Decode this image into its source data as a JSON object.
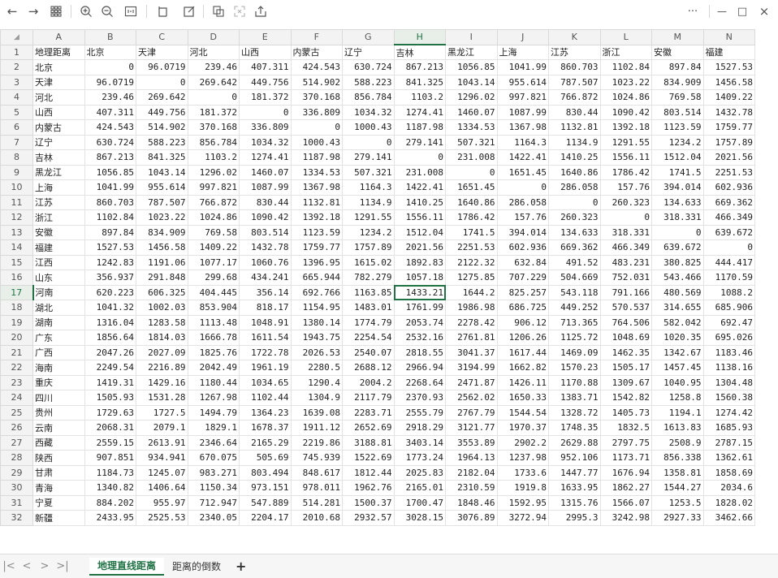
{
  "toolbar": {
    "back_icon": "←",
    "forward_icon": "→",
    "apps_icon": "grid",
    "zoom_in_icon": "zoom-in",
    "zoom_out_icon": "zoom-out",
    "fit_icon": "fit",
    "more_icon": "···",
    "minimize_icon": "—",
    "maximize_icon": "□",
    "close_icon": "×"
  },
  "sheet": {
    "corner_mark": "◢",
    "columns": [
      "A",
      "B",
      "C",
      "D",
      "E",
      "F",
      "G",
      "H",
      "I",
      "J",
      "K",
      "L",
      "M",
      "N"
    ],
    "active_column": "H",
    "active_row": 17,
    "selected_cell": "H17",
    "rows": [
      {
        "n": 1,
        "cells": [
          "地理距离",
          "北京",
          "天津",
          "河北",
          "山西",
          "内蒙古",
          "辽宁",
          "吉林",
          "黑龙江",
          "上海",
          "江苏",
          "浙江",
          "安徽",
          "福建"
        ]
      },
      {
        "n": 2,
        "cells": [
          "北京",
          "0",
          "96.0719",
          "239.46",
          "407.311",
          "424.543",
          "630.724",
          "867.213",
          "1056.85",
          "1041.99",
          "860.703",
          "1102.84",
          "897.84",
          "1527.53"
        ]
      },
      {
        "n": 3,
        "cells": [
          "天津",
          "96.0719",
          "0",
          "269.642",
          "449.756",
          "514.902",
          "588.223",
          "841.325",
          "1043.14",
          "955.614",
          "787.507",
          "1023.22",
          "834.909",
          "1456.58"
        ]
      },
      {
        "n": 4,
        "cells": [
          "河北",
          "239.46",
          "269.642",
          "0",
          "181.372",
          "370.168",
          "856.784",
          "1103.2",
          "1296.02",
          "997.821",
          "766.872",
          "1024.86",
          "769.58",
          "1409.22"
        ]
      },
      {
        "n": 5,
        "cells": [
          "山西",
          "407.311",
          "449.756",
          "181.372",
          "0",
          "336.809",
          "1034.32",
          "1274.41",
          "1460.07",
          "1087.99",
          "830.44",
          "1090.42",
          "803.514",
          "1432.78"
        ]
      },
      {
        "n": 6,
        "cells": [
          "内蒙古",
          "424.543",
          "514.902",
          "370.168",
          "336.809",
          "0",
          "1000.43",
          "1187.98",
          "1334.53",
          "1367.98",
          "1132.81",
          "1392.18",
          "1123.59",
          "1759.77"
        ]
      },
      {
        "n": 7,
        "cells": [
          "辽宁",
          "630.724",
          "588.223",
          "856.784",
          "1034.32",
          "1000.43",
          "0",
          "279.141",
          "507.321",
          "1164.3",
          "1134.9",
          "1291.55",
          "1234.2",
          "1757.89"
        ]
      },
      {
        "n": 8,
        "cells": [
          "吉林",
          "867.213",
          "841.325",
          "1103.2",
          "1274.41",
          "1187.98",
          "279.141",
          "0",
          "231.008",
          "1422.41",
          "1410.25",
          "1556.11",
          "1512.04",
          "2021.56"
        ]
      },
      {
        "n": 9,
        "cells": [
          "黑龙江",
          "1056.85",
          "1043.14",
          "1296.02",
          "1460.07",
          "1334.53",
          "507.321",
          "231.008",
          "0",
          "1651.45",
          "1640.86",
          "1786.42",
          "1741.5",
          "2251.53"
        ]
      },
      {
        "n": 10,
        "cells": [
          "上海",
          "1041.99",
          "955.614",
          "997.821",
          "1087.99",
          "1367.98",
          "1164.3",
          "1422.41",
          "1651.45",
          "0",
          "286.058",
          "157.76",
          "394.014",
          "602.936"
        ]
      },
      {
        "n": 11,
        "cells": [
          "江苏",
          "860.703",
          "787.507",
          "766.872",
          "830.44",
          "1132.81",
          "1134.9",
          "1410.25",
          "1640.86",
          "286.058",
          "0",
          "260.323",
          "134.633",
          "669.362"
        ]
      },
      {
        "n": 12,
        "cells": [
          "浙江",
          "1102.84",
          "1023.22",
          "1024.86",
          "1090.42",
          "1392.18",
          "1291.55",
          "1556.11",
          "1786.42",
          "157.76",
          "260.323",
          "0",
          "318.331",
          "466.349"
        ]
      },
      {
        "n": 13,
        "cells": [
          "安徽",
          "897.84",
          "834.909",
          "769.58",
          "803.514",
          "1123.59",
          "1234.2",
          "1512.04",
          "1741.5",
          "394.014",
          "134.633",
          "318.331",
          "0",
          "639.672"
        ]
      },
      {
        "n": 14,
        "cells": [
          "福建",
          "1527.53",
          "1456.58",
          "1409.22",
          "1432.78",
          "1759.77",
          "1757.89",
          "2021.56",
          "2251.53",
          "602.936",
          "669.362",
          "466.349",
          "639.672",
          "0"
        ]
      },
      {
        "n": 15,
        "cells": [
          "江西",
          "1242.83",
          "1191.06",
          "1077.17",
          "1060.76",
          "1396.95",
          "1615.02",
          "1892.83",
          "2122.32",
          "632.84",
          "491.52",
          "483.231",
          "380.825",
          "444.417"
        ]
      },
      {
        "n": 16,
        "cells": [
          "山东",
          "356.937",
          "291.848",
          "299.68",
          "434.241",
          "665.944",
          "782.279",
          "1057.18",
          "1275.85",
          "707.229",
          "504.669",
          "752.031",
          "543.466",
          "1170.59"
        ]
      },
      {
        "n": 17,
        "cells": [
          "河南",
          "620.223",
          "606.325",
          "404.445",
          "356.14",
          "692.766",
          "1163.85",
          "1433.21",
          "1644.2",
          "825.257",
          "543.118",
          "791.166",
          "480.569",
          "1088.2"
        ]
      },
      {
        "n": 18,
        "cells": [
          "湖北",
          "1041.32",
          "1002.03",
          "853.904",
          "818.17",
          "1154.95",
          "1483.01",
          "1761.99",
          "1986.98",
          "686.725",
          "449.252",
          "570.537",
          "314.655",
          "685.906"
        ]
      },
      {
        "n": 19,
        "cells": [
          "湖南",
          "1316.04",
          "1283.58",
          "1113.48",
          "1048.91",
          "1380.14",
          "1774.79",
          "2053.74",
          "2278.42",
          "906.12",
          "713.365",
          "764.506",
          "582.042",
          "692.47"
        ]
      },
      {
        "n": 20,
        "cells": [
          "广东",
          "1856.64",
          "1814.03",
          "1666.78",
          "1611.54",
          "1943.75",
          "2254.54",
          "2532.16",
          "2761.81",
          "1206.26",
          "1125.72",
          "1048.69",
          "1020.35",
          "695.026"
        ]
      },
      {
        "n": 21,
        "cells": [
          "广西",
          "2047.26",
          "2027.09",
          "1825.76",
          "1722.78",
          "2026.53",
          "2540.07",
          "2818.55",
          "3041.37",
          "1617.44",
          "1469.09",
          "1462.35",
          "1342.67",
          "1183.46"
        ]
      },
      {
        "n": 22,
        "cells": [
          "海南",
          "2249.54",
          "2216.89",
          "2042.49",
          "1961.19",
          "2280.5",
          "2688.12",
          "2966.94",
          "3194.99",
          "1662.82",
          "1570.23",
          "1505.17",
          "1457.45",
          "1138.16"
        ]
      },
      {
        "n": 23,
        "cells": [
          "重庆",
          "1419.31",
          "1429.16",
          "1180.44",
          "1034.65",
          "1290.4",
          "2004.2",
          "2268.64",
          "2471.87",
          "1426.11",
          "1170.88",
          "1309.67",
          "1040.95",
          "1304.48"
        ]
      },
      {
        "n": 24,
        "cells": [
          "四川",
          "1505.93",
          "1531.28",
          "1267.98",
          "1102.44",
          "1304.9",
          "2117.79",
          "2370.93",
          "2562.02",
          "1650.33",
          "1383.71",
          "1542.82",
          "1258.8",
          "1560.38"
        ]
      },
      {
        "n": 25,
        "cells": [
          "贵州",
          "1729.63",
          "1727.5",
          "1494.79",
          "1364.23",
          "1639.08",
          "2283.71",
          "2555.79",
          "2767.79",
          "1544.54",
          "1328.72",
          "1405.73",
          "1194.1",
          "1274.42"
        ]
      },
      {
        "n": 26,
        "cells": [
          "云南",
          "2068.31",
          "2079.1",
          "1829.1",
          "1678.37",
          "1911.12",
          "2652.69",
          "2918.29",
          "3121.77",
          "1970.37",
          "1748.35",
          "1832.5",
          "1613.83",
          "1685.93"
        ]
      },
      {
        "n": 27,
        "cells": [
          "西藏",
          "2559.15",
          "2613.91",
          "2346.64",
          "2165.29",
          "2219.86",
          "3188.81",
          "3403.14",
          "3553.89",
          "2902.2",
          "2629.88",
          "2797.75",
          "2508.9",
          "2787.15"
        ]
      },
      {
        "n": 28,
        "cells": [
          "陕西",
          "907.851",
          "934.941",
          "670.075",
          "505.69",
          "745.939",
          "1522.69",
          "1773.24",
          "1964.13",
          "1237.98",
          "952.106",
          "1173.71",
          "856.338",
          "1362.61"
        ]
      },
      {
        "n": 29,
        "cells": [
          "甘肃",
          "1184.73",
          "1245.07",
          "983.271",
          "803.494",
          "848.617",
          "1812.44",
          "2025.83",
          "2182.04",
          "1733.6",
          "1447.77",
          "1676.94",
          "1358.81",
          "1858.69"
        ]
      },
      {
        "n": 30,
        "cells": [
          "青海",
          "1340.82",
          "1406.64",
          "1150.34",
          "973.151",
          "978.011",
          "1962.76",
          "2165.01",
          "2310.59",
          "1919.8",
          "1633.95",
          "1862.27",
          "1544.27",
          "2034.6"
        ]
      },
      {
        "n": 31,
        "cells": [
          "宁夏",
          "884.202",
          "955.97",
          "712.947",
          "547.889",
          "514.281",
          "1500.37",
          "1700.47",
          "1848.46",
          "1592.95",
          "1315.76",
          "1566.07",
          "1253.5",
          "1828.02"
        ]
      },
      {
        "n": 32,
        "cells": [
          "新疆",
          "2433.95",
          "2525.53",
          "2340.05",
          "2204.17",
          "2010.68",
          "2932.57",
          "3028.15",
          "3076.89",
          "3272.94",
          "2995.3",
          "3242.98",
          "2927.33",
          "3462.66"
        ]
      }
    ]
  },
  "tabs": {
    "nav": [
      "|<",
      "<",
      ">",
      ">|"
    ],
    "sheets": [
      "地理直线距离",
      "距离的倒数"
    ],
    "active_sheet": "地理直线距离",
    "add_label": "+"
  }
}
